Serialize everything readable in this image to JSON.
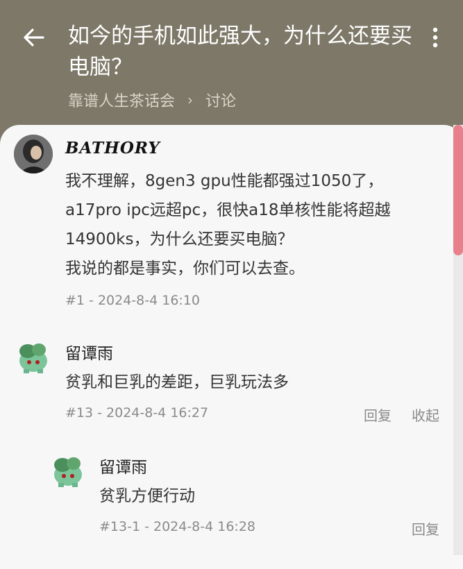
{
  "header": {
    "title": "如今的手机如此强大，为什么还要买电脑？",
    "breadcrumb": {
      "forum": "靠谱人生茶话会",
      "section": "讨论"
    }
  },
  "posts": [
    {
      "username": "BATHORY",
      "lines": [
        "我不理解，8gen3 gpu性能都强过1050了，",
        "a17pro ipc远超pc，很快a18单核性能将超越",
        "14900ks，为什么还要买电脑？",
        "我说的都是事实，你们可以去查。"
      ],
      "meta": "#1 - 2024-8-4 16:10"
    },
    {
      "username": "留谭雨",
      "content": "贫乳和巨乳的差距，巨乳玩法多",
      "meta": "#13 - 2024-8-4 16:27",
      "reply_label": "回复",
      "collapse_label": "收起"
    },
    {
      "username": "留谭雨",
      "content": "贫乳方便行动",
      "meta": "#13-1 - 2024-8-4 16:28",
      "reply_label": "回复"
    }
  ],
  "colors": {
    "header_bg": "#7d7868",
    "card_bg": "#f7f7f7",
    "scroll_thumb": "#e8808c"
  },
  "icons": {
    "back": "arrow-left-icon",
    "more": "more-vertical-icon",
    "breadcrumb_sep": "chevron-right-icon"
  }
}
